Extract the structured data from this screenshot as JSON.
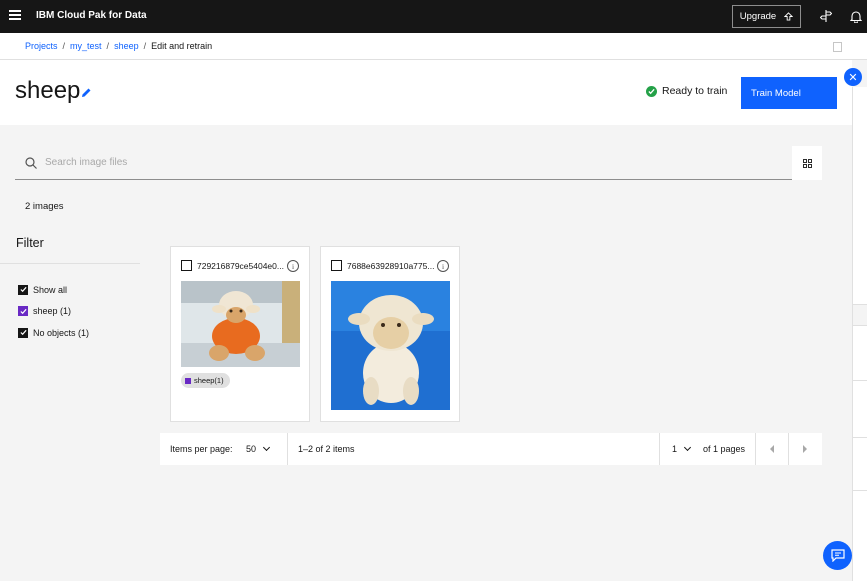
{
  "topbar": {
    "brand_prefix": "IBM",
    "brand_name": "Cloud Pak for Data",
    "upgrade_label": "Upgrade"
  },
  "breadcrumb": {
    "items": [
      "Projects",
      "my_test",
      "sheep"
    ],
    "current": "Edit and retrain",
    "separator": "/"
  },
  "header": {
    "title": "sheep",
    "status": "Ready to train",
    "train_button": "Train Model"
  },
  "search": {
    "placeholder": "Search image files"
  },
  "summary": {
    "count_text": "2 images"
  },
  "filter": {
    "title": "Filter",
    "items": [
      {
        "label": "Show all",
        "checked": true
      },
      {
        "label": "sheep (1)",
        "checked": true,
        "color": "#6929c4"
      },
      {
        "label": "No objects (1)",
        "checked": true
      }
    ]
  },
  "cards": [
    {
      "name": "729216879ce5404e0...",
      "tag": "sheep(1)"
    },
    {
      "name": "7688e63928910a775..."
    }
  ],
  "pagination": {
    "items_per_page_label": "Items per page:",
    "items_per_page": "50",
    "range": "1–2 of 2 items",
    "page": "1",
    "of_pages": "of 1 pages"
  },
  "colors": {
    "accent": "#0f62fe",
    "success": "#24a148",
    "tag": "#6929c4",
    "topbar": "#161616"
  }
}
